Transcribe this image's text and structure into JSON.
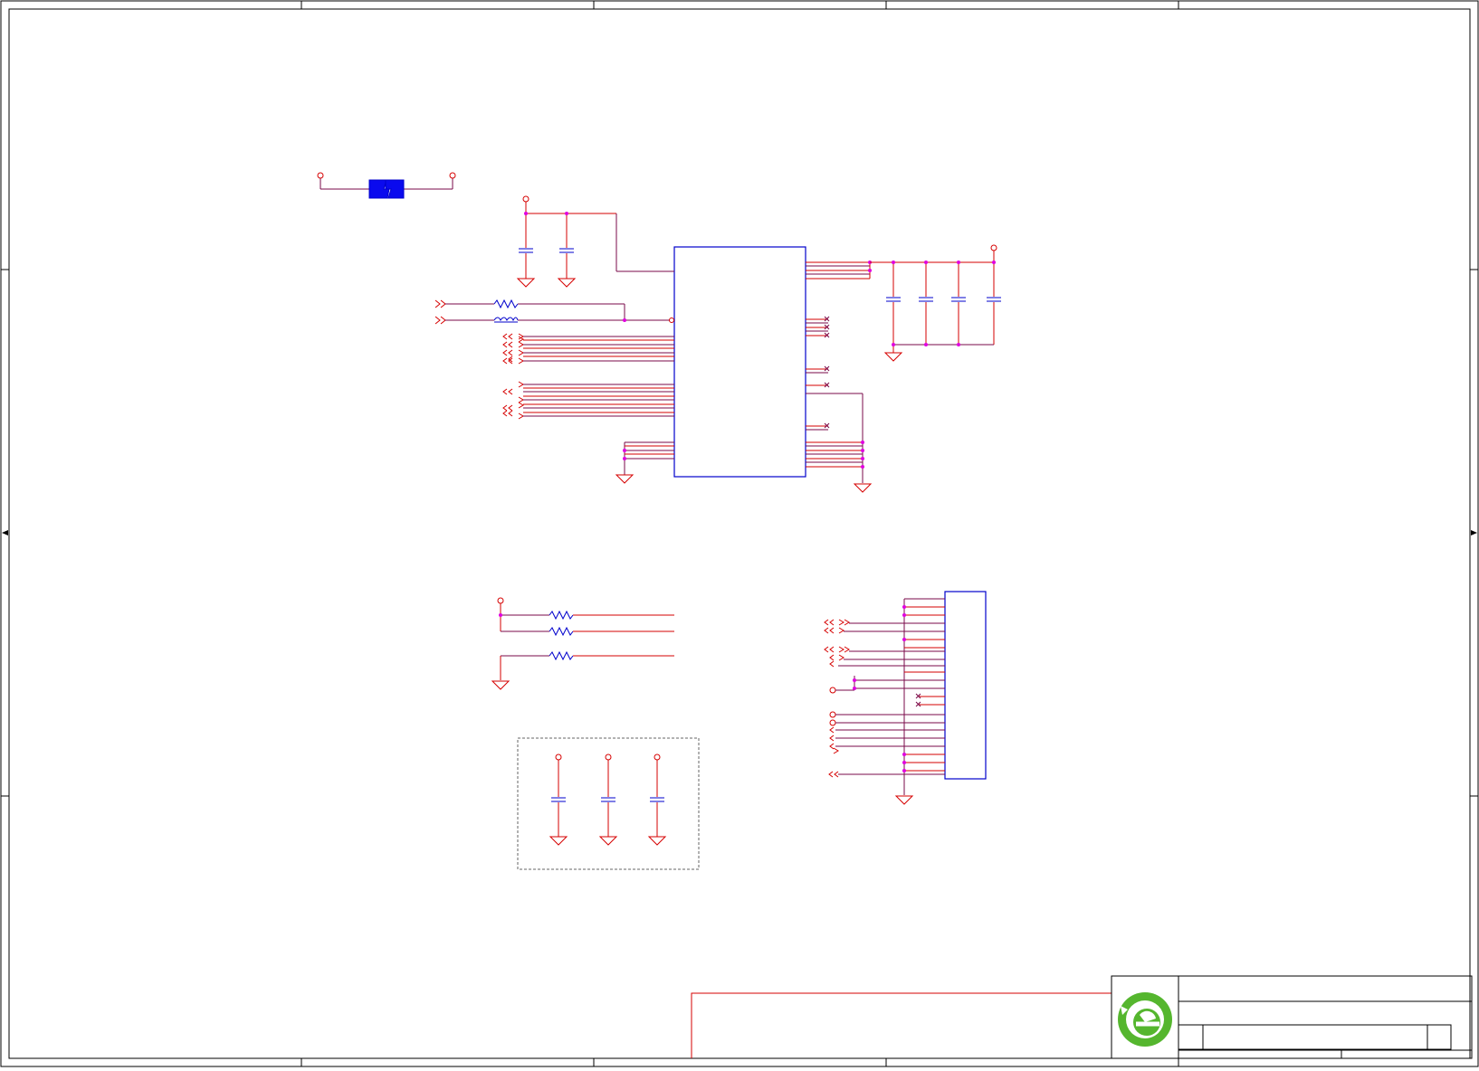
{
  "sheet": {
    "kind": "schematic",
    "colors": {
      "frame": "#000000",
      "wire": "#d60000",
      "net": "#7a0a4a",
      "part": "#0000cc",
      "junction": "#e000e0",
      "fill": "#0a0aee",
      "logo": "#55b62e"
    },
    "title_block": {
      "logo_icon": "green-e-logo-icon"
    }
  }
}
